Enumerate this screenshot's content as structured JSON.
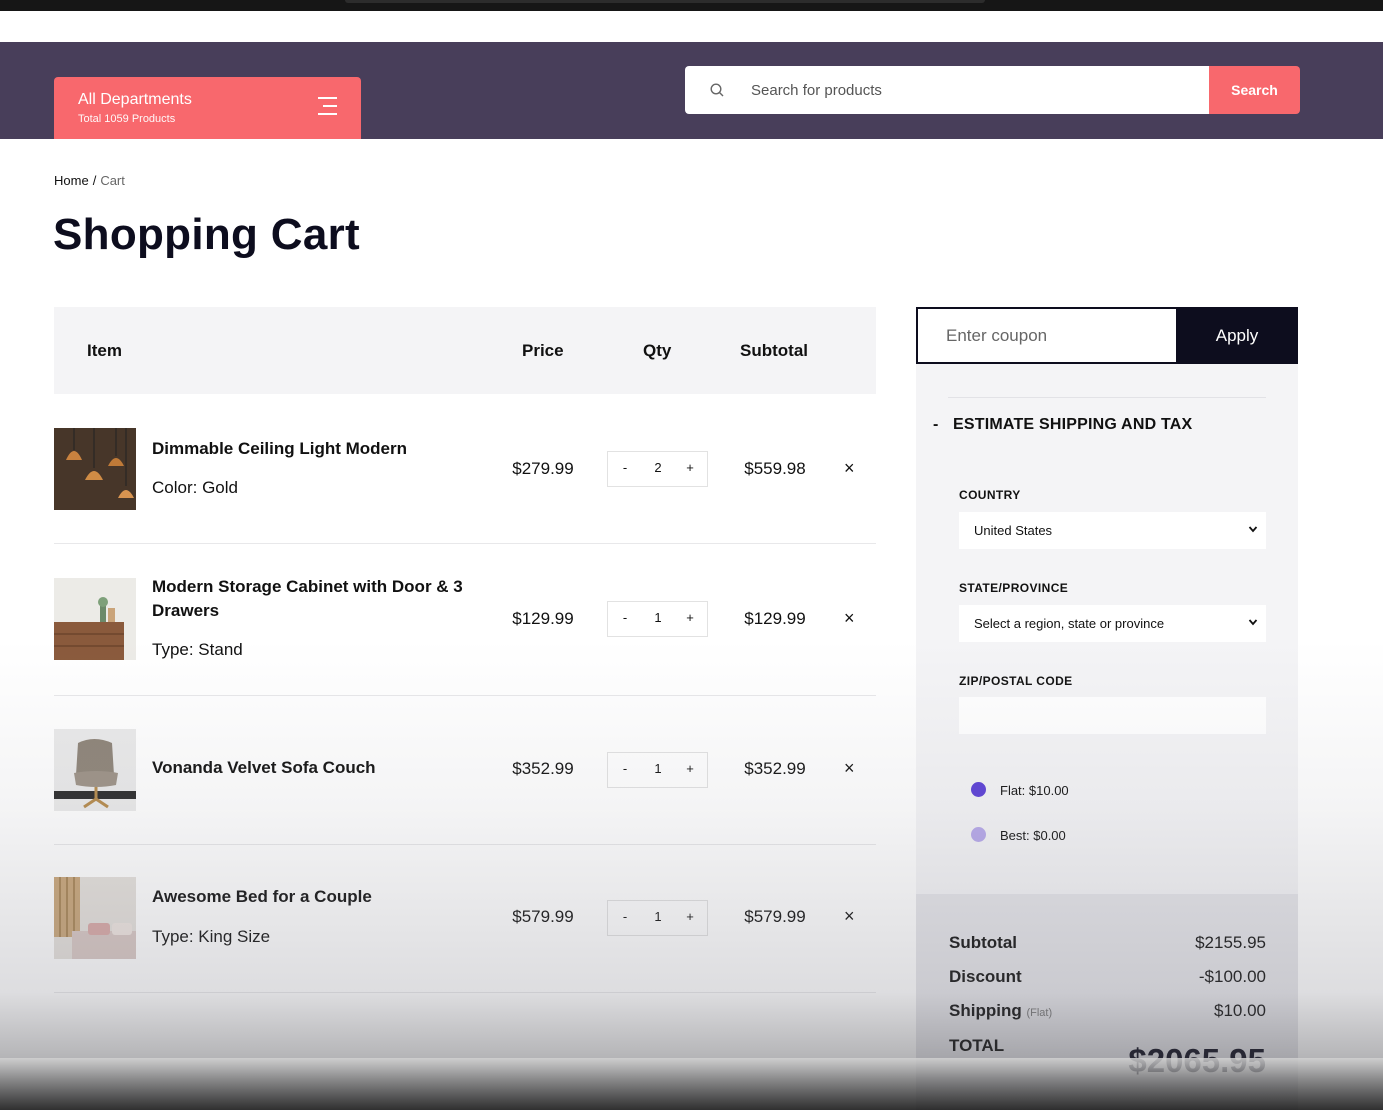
{
  "header": {
    "departments_title": "All Departments",
    "departments_subtitle": "Total 1059 Products",
    "search_placeholder": "Search for products",
    "search_button": "Search"
  },
  "breadcrumb": {
    "home": "Home",
    "separator": "/",
    "current": "Cart"
  },
  "page_title": "Shopping Cart",
  "cart": {
    "columns": {
      "item": "Item",
      "price": "Price",
      "qty": "Qty",
      "subtotal": "Subtotal"
    },
    "qty_minus": "-",
    "qty_plus": "+",
    "remove_symbol": "×",
    "items": [
      {
        "name": "Dimmable Ceiling Light Modern",
        "variant": "Color: Gold",
        "price": "$279.99",
        "qty": "2",
        "subtotal": "$559.98"
      },
      {
        "name": "Modern Storage Cabinet with Door & 3 Drawers",
        "variant": "Type: Stand",
        "price": "$129.99",
        "qty": "1",
        "subtotal": "$129.99"
      },
      {
        "name": "Vonanda Velvet Sofa Couch",
        "variant": "",
        "price": "$352.99",
        "qty": "1",
        "subtotal": "$352.99"
      },
      {
        "name": "Awesome Bed for a Couple",
        "variant": "Type: King Size",
        "price": "$579.99",
        "qty": "1",
        "subtotal": "$579.99"
      }
    ]
  },
  "coupon": {
    "placeholder": "Enter coupon",
    "apply": "Apply"
  },
  "shipping": {
    "toggle": "-",
    "title": "ESTIMATE SHIPPING AND TAX",
    "country_label": "COUNTRY",
    "country_value": "United States",
    "state_label": "STATE/PROVINCE",
    "state_value": "Select a region, state or province",
    "zip_label": "ZIP/POSTAL CODE",
    "zip_value": "",
    "options": [
      {
        "label": "Flat: $10.00",
        "selected": true
      },
      {
        "label": "Best: $0.00",
        "selected": false
      }
    ]
  },
  "totals": {
    "subtotal_label": "Subtotal",
    "subtotal": "$2155.95",
    "discount_label": "Discount",
    "discount": "-$100.00",
    "shipping_label": "Shipping",
    "shipping_method": "(Flat)",
    "shipping": "$10.00",
    "total_label": "TOTAL",
    "total": "$2065.95"
  },
  "colors": {
    "header_bg": "#483e5a",
    "accent": "#f8686d",
    "dark": "#0d0d1e",
    "radio_selected": "#5b3fd6",
    "radio_unselected": "#b6a8ea"
  }
}
